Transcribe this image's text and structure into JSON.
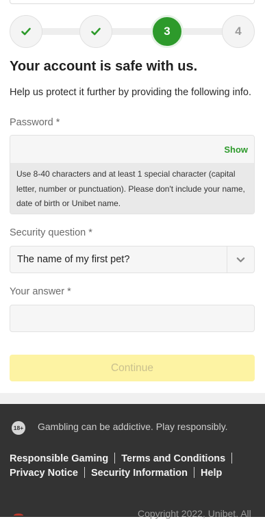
{
  "stepper": {
    "steps": [
      {
        "label": "",
        "state": "done",
        "icon": "check-icon"
      },
      {
        "label": "",
        "state": "done",
        "icon": "check-icon"
      },
      {
        "label": "3",
        "state": "active"
      },
      {
        "label": "4",
        "state": "upcoming"
      }
    ],
    "accent": "#2d9a2b"
  },
  "header": {
    "title": "Your account is safe with us.",
    "subtitle": "Help us protect it further by providing the following info."
  },
  "password": {
    "label": "Password *",
    "value": "",
    "show_label": "Show",
    "hint": "Use 8-40 characters and at least 1 special character (capital letter, number or punctuation). Please don't include your name, date of birth or Unibet name."
  },
  "security_question": {
    "label": "Security question *",
    "selected": "The name of my first pet?"
  },
  "answer": {
    "label": "Your answer *",
    "value": ""
  },
  "continue_label": "Continue",
  "footer": {
    "age_badge": "18+",
    "responsible_text": "Gambling can be addictive. Play responsibly.",
    "links": [
      "Responsible Gaming",
      "Terms and Conditions",
      "Privacy Notice",
      "Security Information",
      "Help"
    ],
    "copyright": "Copyright 2022, Unibet. All"
  }
}
